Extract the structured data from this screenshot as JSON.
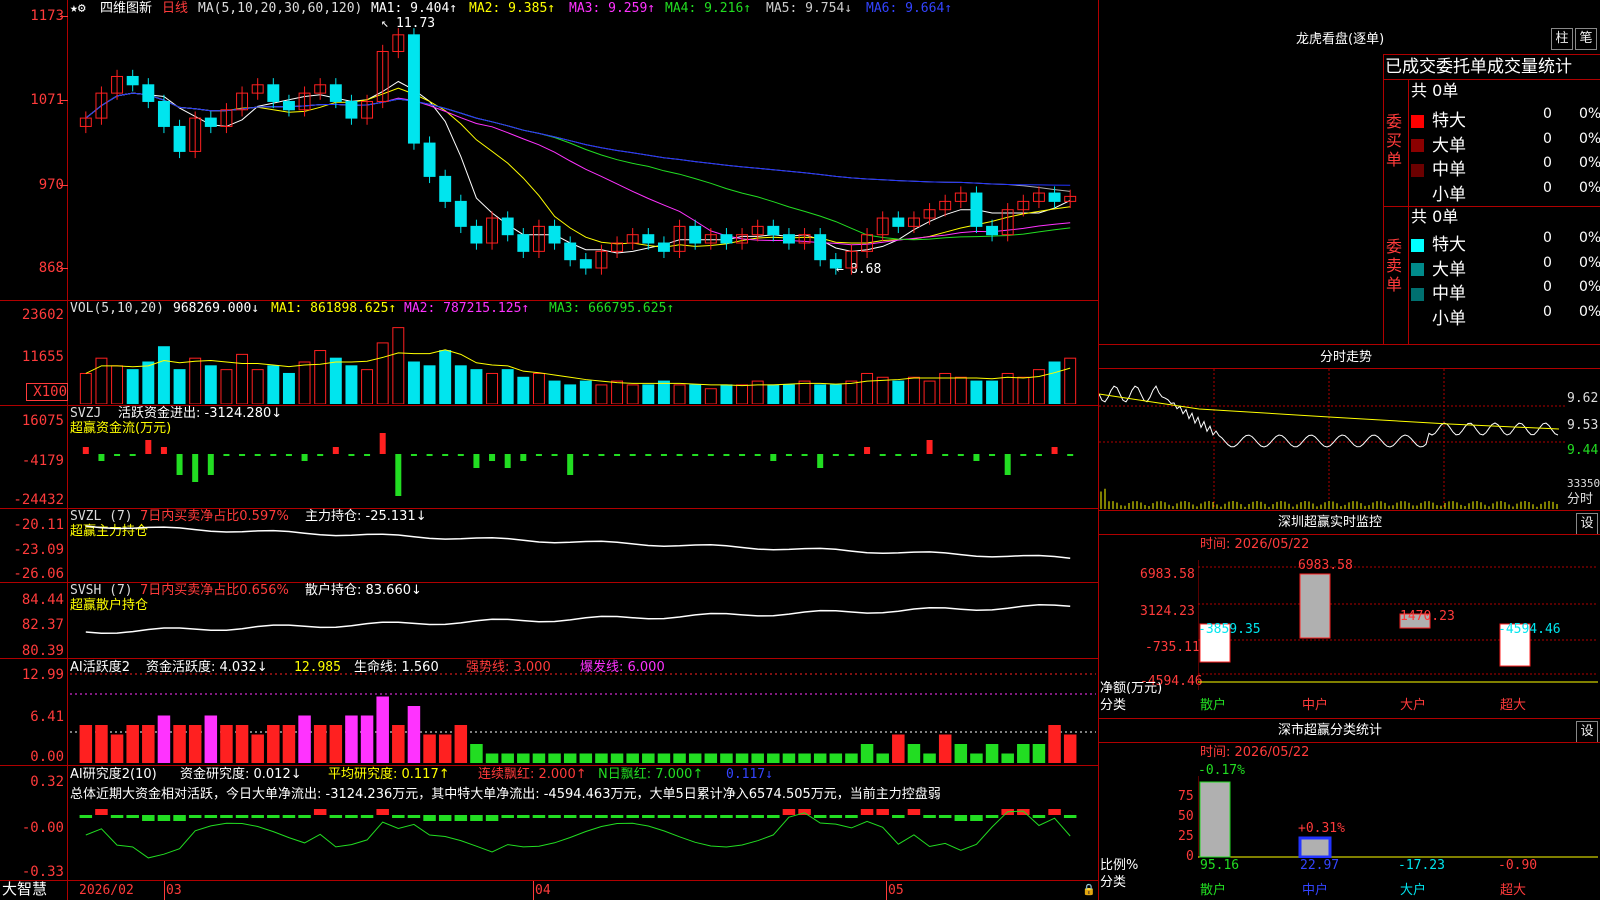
{
  "colors": {
    "up": "#ff2020",
    "down": "#00e5ee",
    "green": "#22dd22",
    "white": "#ffffff",
    "yellow": "#ffff00",
    "magenta": "#ff33ff",
    "gray": "#b0b0b0",
    "blue": "#2233ff",
    "grid": "#b00000",
    "label": "#ff3b3b"
  },
  "header": {
    "title": "四维图新",
    "period": "日线",
    "ma_prefix": "MA(5,10,20,30,60,120)",
    "ma1": "MA1: 9.404↑",
    "ma2": "MA2: 9.385↑",
    "ma3": "MA3: 9.259↑",
    "ma4": "MA4: 9.216↑",
    "ma5": "MA5: 9.754↓",
    "ma6": "MA6: 9.664↑",
    "hi_mark": "11.73",
    "lo_mark": "8.68",
    "icons": "★⚙"
  },
  "axis": {
    "price": [
      "1173",
      "1071",
      "970",
      "868"
    ],
    "vol": [
      "23602",
      "11655",
      "X100"
    ],
    "svzj": [
      "16075",
      "-4179",
      "-24432"
    ],
    "svzl": [
      "-20.11",
      "-23.09",
      "-26.06"
    ],
    "svsh": [
      "84.44",
      "82.37",
      "80.39"
    ],
    "ai1": [
      "12.99",
      "6.41",
      "0.00"
    ],
    "ai2": [
      "0.32",
      "-0.00",
      "-0.33"
    ],
    "dates": [
      "2026/02",
      "03",
      "04",
      "05"
    ]
  },
  "indicators": {
    "vol": {
      "name": "VOL(5,10,20)",
      "v": "968269.000↓",
      "ma1": "MA1: 861898.625↑",
      "ma2": "MA2: 787215.125↑",
      "ma3": "MA3: 666795.625↑"
    },
    "svzj": {
      "name": "SVZJ",
      "desc": "活跃资金进出: -3124.280↓",
      "sub": "超赢资金流(万元)"
    },
    "svzl": {
      "name": "SVZL (7)",
      "desc": "7日内买卖净占比0.597%",
      "val": "主力持仓: -25.131↓",
      "sub": "超赢主力持仓"
    },
    "svsh": {
      "name": "SVSH (7)",
      "desc": "7日内买卖净占比0.656%",
      "val": "散户持仓: 83.660↓",
      "sub": "超赢散户持仓"
    },
    "ai1": {
      "a": "AI活跃度2",
      "b": "资金活跃度: 4.032↓",
      "c": "12.985",
      "d": "生命线: 1.560",
      "e": "强势线: 3.000",
      "f": "爆发线: 6.000"
    },
    "ai2": {
      "a": "AI研究度2(10)",
      "b": "资金研究度: 0.012↓",
      "c": "平均研究度: 0.117↑",
      "d": "连续飘红: 2.000↑",
      "e": "N日飘红: 7.000↑",
      "f": "0.117↓",
      "summary": "总体近期大资金相对活跃，今日大单净流出: -3124.236万元，其中特大单净流出: -4594.463万元，大单5日累计净入6574.505万元，当前主力控盘弱"
    }
  },
  "footer": {
    "brand": "大智慧"
  },
  "right": {
    "lhb_title": "龙虎看盘(逐单)",
    "btn_zhu": "柱",
    "btn_bi": "笔",
    "table_title": "已成交委托单成交量统计",
    "buy_label": "委买单",
    "sell_label": "委卖单",
    "buy_total": "共 0单",
    "sell_total": "共 0单",
    "rows": [
      {
        "name": "特大",
        "n": "0",
        "p": "0%"
      },
      {
        "name": "大单",
        "n": "0",
        "p": "0%"
      },
      {
        "name": "中单",
        "n": "0",
        "p": "0%"
      },
      {
        "name": "小单",
        "n": "0",
        "p": "0%"
      }
    ],
    "buy_colors": [
      "#ff0000",
      "#8b0000",
      "#6b0000",
      "#000000"
    ],
    "sell_colors": [
      "#00ffff",
      "#008b8b",
      "#007070",
      "#000000"
    ],
    "fs_title": "分时走势",
    "fs_axis": [
      "9.62",
      "9.53",
      "9.44",
      "33350",
      "分时"
    ],
    "sz_title": "深圳超赢实时监控",
    "sz_btn": "设",
    "sz_time": "时间: 2026/05/22",
    "sz_axis": [
      "6983.58",
      "3124.23",
      "-735.11",
      "-4594.46"
    ],
    "sz_vals": [
      "-3859.35",
      "6983.58",
      "1470.23",
      "-4594.46"
    ],
    "sz_ylabel1": "净额(万元)",
    "sz_ylabel2": "分类",
    "cats": [
      "散户",
      "中户",
      "大户",
      "超大"
    ],
    "ss_title": "深市超赢分类统计",
    "ss_btn": "设",
    "ss_time": "时间: 2026/05/22",
    "ss_axis": [
      "75",
      "50",
      "25",
      "0"
    ],
    "ss_top": [
      "-0.17%",
      "+0.31%"
    ],
    "ss_vals": [
      "95.16",
      "22.97",
      "-17.23",
      "-0.90"
    ],
    "ss_ylabel1": "比例%",
    "ss_ylabel2": "分类"
  },
  "chart_data": {
    "type": "candlestick",
    "price_range": [
      8.68,
      11.73
    ],
    "closes": [
      10.6,
      10.9,
      11.1,
      11.0,
      10.8,
      10.5,
      10.2,
      10.6,
      10.5,
      10.7,
      10.9,
      11.0,
      10.8,
      10.7,
      10.9,
      11.0,
      10.8,
      10.6,
      10.8,
      11.4,
      11.6,
      10.3,
      9.9,
      9.6,
      9.3,
      9.1,
      9.4,
      9.2,
      9.0,
      9.3,
      9.1,
      8.9,
      8.8,
      9.0,
      9.1,
      9.2,
      9.1,
      9.0,
      9.3,
      9.1,
      9.2,
      9.1,
      9.2,
      9.3,
      9.2,
      9.1,
      9.2,
      8.9,
      8.8,
      9.0,
      9.2,
      9.4,
      9.3,
      9.4,
      9.5,
      9.6,
      9.7,
      9.3,
      9.2,
      9.5,
      9.6,
      9.7,
      9.6,
      9.66
    ],
    "volumes": [
      8,
      12,
      10,
      9,
      11,
      15,
      9,
      12,
      10,
      9,
      13,
      9,
      10,
      8,
      11,
      14,
      12,
      10,
      9,
      16,
      20,
      11,
      10,
      14,
      10,
      9,
      8,
      9,
      7,
      8,
      6,
      5,
      6,
      5,
      6,
      5,
      5,
      6,
      5,
      5,
      4,
      5,
      5,
      6,
      5,
      5,
      6,
      5,
      5,
      6,
      8,
      7,
      6,
      7,
      6,
      8,
      7,
      6,
      6,
      8,
      7,
      9,
      11,
      12
    ],
    "svzj": [
      1,
      -1,
      0,
      0,
      2,
      1,
      -3,
      -4,
      -3,
      0,
      0,
      0,
      0,
      0,
      -1,
      0,
      1,
      0,
      0,
      3,
      -6,
      0,
      0,
      0,
      0,
      -2,
      -1,
      -2,
      -1,
      0,
      0,
      -3,
      0,
      0,
      0,
      0,
      0,
      0,
      0,
      0,
      0,
      0,
      0,
      0,
      -1,
      0,
      0,
      -2,
      0,
      0,
      1,
      0,
      0,
      0,
      2,
      0,
      0,
      -1,
      0,
      -3,
      0,
      0,
      1,
      0
    ],
    "ai1": [
      4,
      4,
      3,
      4,
      4,
      5,
      4,
      4,
      5,
      4,
      4,
      3,
      4,
      4,
      5,
      4,
      4,
      5,
      5,
      7,
      4,
      6,
      3,
      3,
      4,
      2,
      1,
      1,
      1,
      1,
      1,
      1,
      1,
      1,
      1,
      1,
      1,
      1,
      1,
      1,
      1,
      1,
      1,
      1,
      1,
      1,
      1,
      1,
      1,
      1,
      2,
      1,
      3,
      2,
      1,
      3,
      2,
      1,
      2,
      1,
      2,
      2,
      4,
      3
    ],
    "ai2": [
      0,
      0.1,
      0,
      0,
      -0.1,
      -0.1,
      -0.1,
      0,
      0,
      0,
      0,
      0,
      0,
      0,
      0,
      0.1,
      0,
      0,
      0,
      0.1,
      0,
      0,
      -0.1,
      -0.1,
      -0.1,
      -0.1,
      -0.1,
      0,
      0,
      0,
      0,
      0,
      0,
      0,
      0,
      0,
      0,
      0,
      0,
      0,
      0,
      0,
      0,
      0,
      0,
      0.1,
      0.1,
      0,
      0,
      0,
      0.1,
      0.1,
      0,
      0.1,
      0,
      0,
      -0.1,
      -0.1,
      0,
      0.1,
      0.1,
      0,
      0.1,
      0
    ]
  }
}
